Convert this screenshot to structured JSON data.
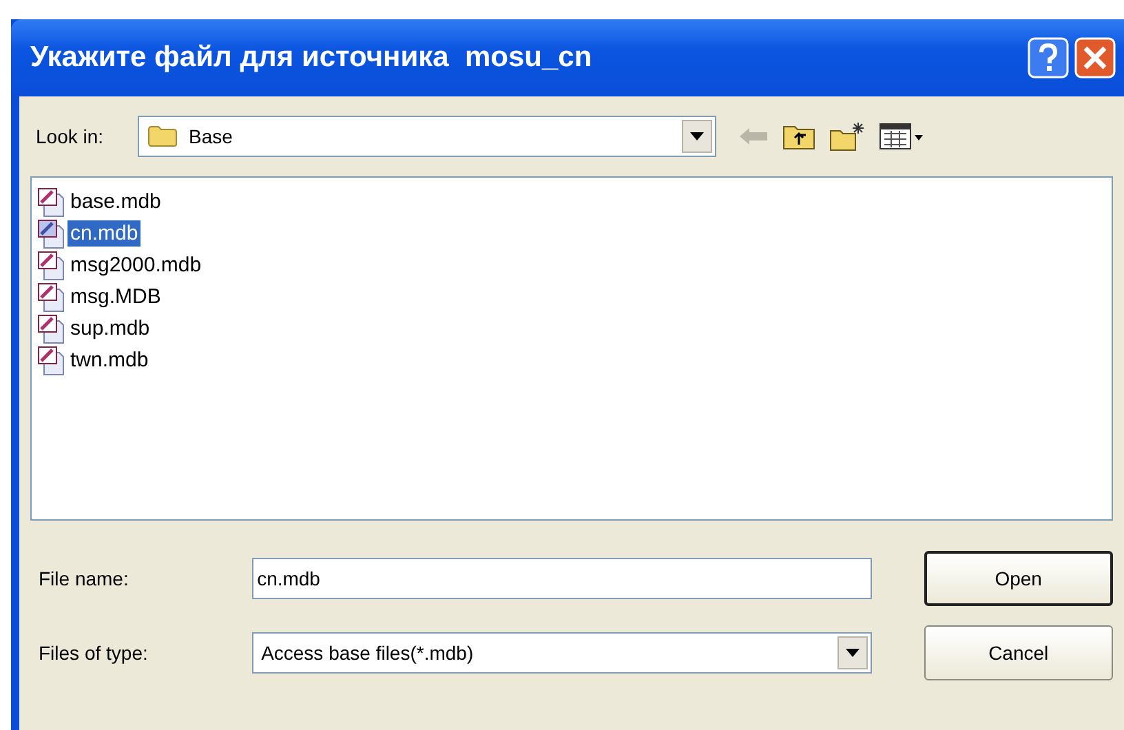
{
  "window": {
    "title": "Укажите файл для источника  mosu_cn"
  },
  "look_in": {
    "label": "Look in:",
    "value": "Base"
  },
  "files": [
    {
      "name": "base.mdb",
      "selected": false
    },
    {
      "name": "cn.mdb",
      "selected": true
    },
    {
      "name": "msg2000.mdb",
      "selected": false
    },
    {
      "name": "msg.MDB",
      "selected": false
    },
    {
      "name": "sup.mdb",
      "selected": false
    },
    {
      "name": "twn.mdb",
      "selected": false
    }
  ],
  "file_name": {
    "label": "File name:",
    "value": "cn.mdb"
  },
  "file_type": {
    "label": "Files of type:",
    "value": "Access base files(*.mdb)"
  },
  "buttons": [
    {
      "label": "Open",
      "default": true
    },
    {
      "label": "Cancel",
      "default": false
    }
  ]
}
